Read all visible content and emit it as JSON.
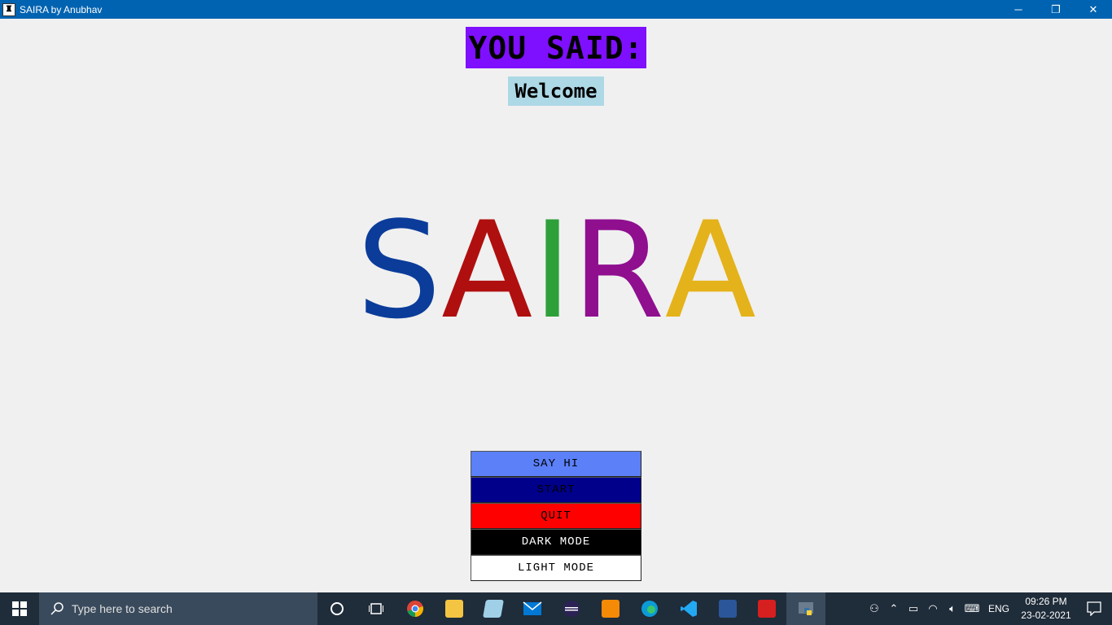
{
  "window": {
    "title": "SAIRA by Anubhav",
    "controls": {
      "minimize": "─",
      "restore": "❐",
      "close": "✕"
    }
  },
  "main": {
    "heading": "YOU SAID:",
    "said_text": "Welcome",
    "logo_letters": [
      "S",
      "A",
      "I",
      "R",
      "A"
    ],
    "logo_colors": [
      "#0b3c9a",
      "#b00f0f",
      "#2ea03a",
      "#8f0f8f",
      "#e4b21a"
    ]
  },
  "buttons": {
    "say_hi": "SAY HI",
    "start": "START",
    "quit": "QUIT",
    "dark_mode": "DARK MODE",
    "light_mode": "LIGHT MODE"
  },
  "taskbar": {
    "search_placeholder": "Type here to search",
    "apps": [
      "cortana-icon",
      "task-view-icon",
      "chrome-icon",
      "file-explorer-icon",
      "notepad-icon",
      "mail-icon",
      "eclipse-icon",
      "sublime-icon",
      "edge-icon",
      "vscode-icon",
      "word-icon",
      "acrobat-icon",
      "python-icon"
    ],
    "language": "ENG",
    "time": "09:26 PM",
    "date": "23-02-2021"
  }
}
